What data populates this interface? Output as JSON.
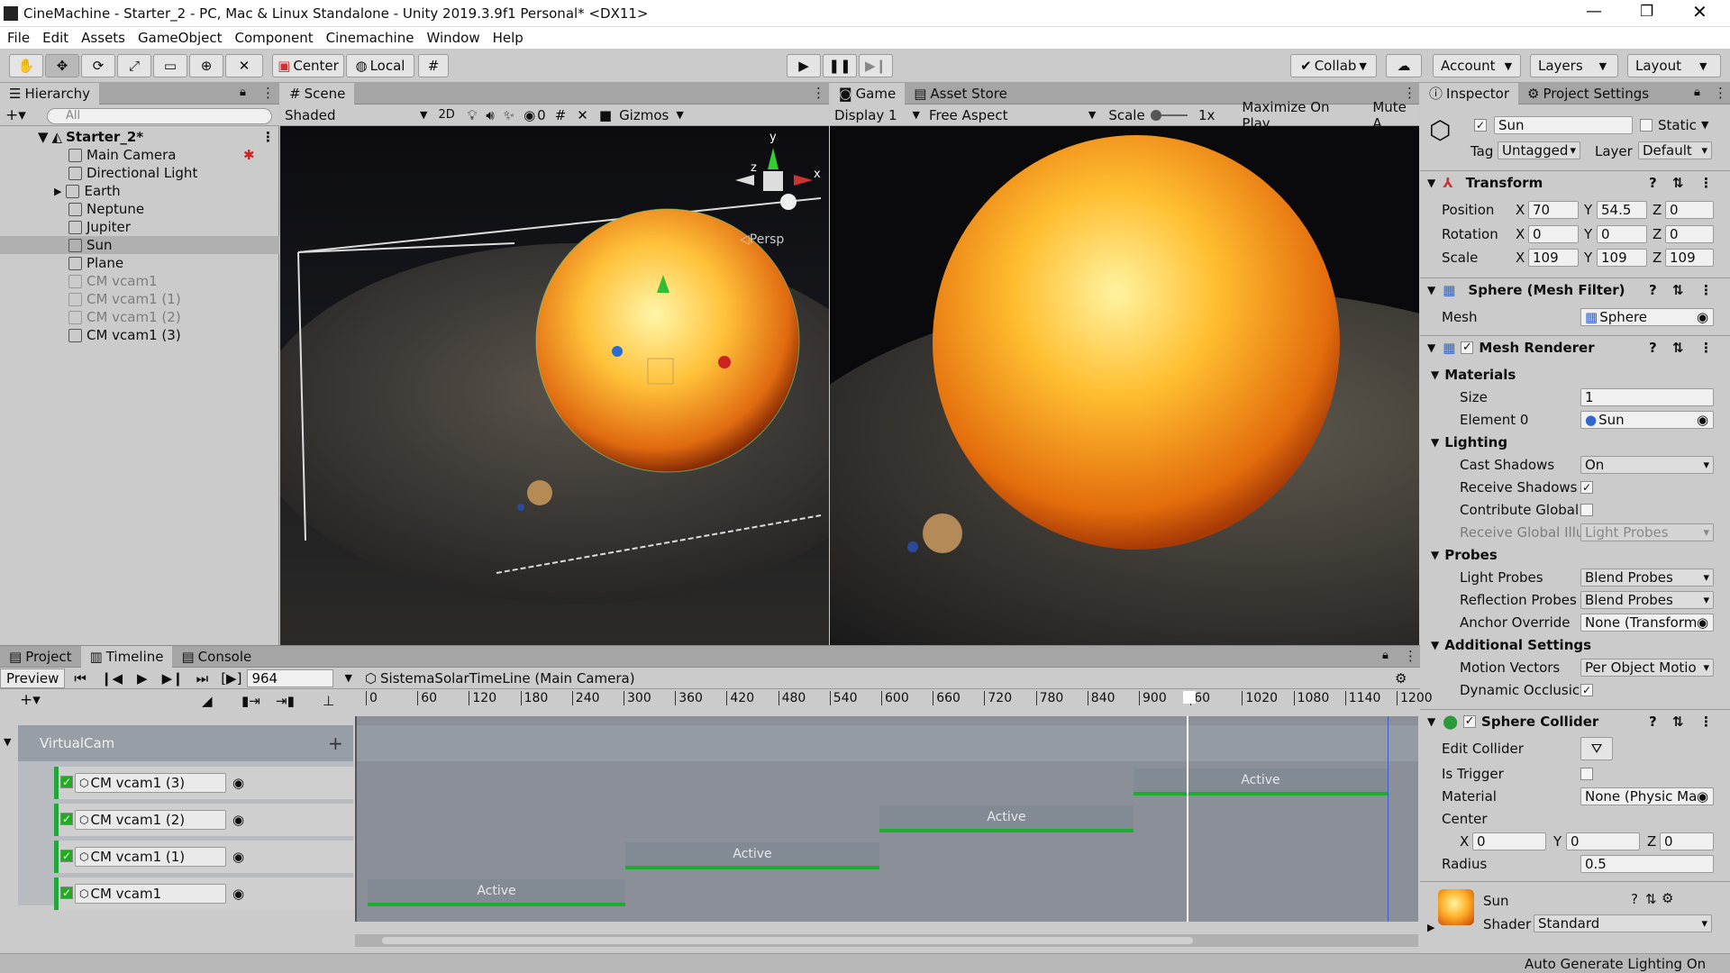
{
  "title": "CineMachine - Starter_2 - PC, Mac & Linux Standalone - Unity 2019.3.9f1 Personal* <DX11>",
  "menu": [
    "File",
    "Edit",
    "Assets",
    "GameObject",
    "Component",
    "Cinemachine",
    "Window",
    "Help"
  ],
  "toolbar": {
    "center": "Center",
    "local": "Local",
    "collab": "Collab",
    "account": "Account",
    "layers": "Layers",
    "layout": "Layout"
  },
  "hierarchy": {
    "tab": "Hierarchy",
    "search": "All",
    "scene": "Starter_2*",
    "items": [
      "Main Camera",
      "Directional Light",
      "Earth",
      "Neptune",
      "Jupiter",
      "Sun",
      "Plane",
      "CM vcam1",
      "CM vcam1 (1)",
      "CM vcam1 (2)",
      "CM vcam1 (3)"
    ]
  },
  "scene": {
    "tab": "Scene",
    "shading": "Shaded",
    "mode2d": "2D",
    "hidden_count": "0",
    "gizmos": "Gizmos",
    "persp": "Persp"
  },
  "game": {
    "tab": "Game",
    "asset_tab": "Asset Store",
    "display": "Display 1",
    "aspect": "Free Aspect",
    "scale_label": "Scale",
    "scale_value": "1x",
    "maximize": "Maximize On Play",
    "mute": "Mute A"
  },
  "inspector": {
    "tab": "Inspector",
    "settings_tab": "Project Settings",
    "name": "Sun",
    "static": "Static",
    "tag_label": "Tag",
    "tag": "Untagged",
    "layer_label": "Layer",
    "layer": "Default",
    "transform": {
      "title": "Transform",
      "position_label": "Position",
      "rotation_label": "Rotation",
      "scale_label": "Scale",
      "pos": [
        "70",
        "54.5",
        "0"
      ],
      "rot": [
        "0",
        "0",
        "0"
      ],
      "scl": [
        "109",
        "109",
        "109"
      ]
    },
    "mesh_filter": {
      "title": "Sphere (Mesh Filter)",
      "mesh_label": "Mesh",
      "mesh": "Sphere"
    },
    "mesh_renderer": {
      "title": "Mesh Renderer",
      "materials": "Materials",
      "size_label": "Size",
      "size": "1",
      "element_label": "Element 0",
      "element": "Sun",
      "lighting": "Lighting",
      "cast_label": "Cast Shadows",
      "cast": "On",
      "receive_label": "Receive Shadows",
      "contribute_label": "Contribute Global",
      "receive_gi_label": "Receive Global Illu",
      "receive_gi": "Light Probes",
      "probes": "Probes",
      "light_probes_label": "Light Probes",
      "light_probes": "Blend Probes",
      "reflection_label": "Reflection Probes",
      "reflection": "Blend Probes",
      "anchor_label": "Anchor Override",
      "anchor": "None (Transform",
      "additional": "Additional Settings",
      "motion_label": "Motion Vectors",
      "motion": "Per Object Motio",
      "dynamic_label": "Dynamic Occlusic"
    },
    "collider": {
      "title": "Sphere Collider",
      "edit_label": "Edit Collider",
      "trigger_label": "Is Trigger",
      "material_label": "Material",
      "material": "None (Physic Ma",
      "center_label": "Center",
      "center": [
        "0",
        "0",
        "0"
      ],
      "radius_label": "Radius",
      "radius": "0.5"
    },
    "material": {
      "name": "Sun",
      "shader_label": "Shader",
      "shader": "Standard"
    }
  },
  "bottom": {
    "tabs": [
      "Project",
      "Timeline",
      "Console"
    ],
    "preview": "Preview",
    "frame": "964",
    "timeline_name": "SistemaSolarTimeLine (Main Camera)",
    "group": "VirtualCam",
    "tracks": [
      "CM vcam1 (3)",
      "CM vcam1 (2)",
      "CM vcam1 (1)",
      "CM vcam1"
    ],
    "clip_label": "Active",
    "ruler": [
      "0",
      "60",
      "120",
      "180",
      "240",
      "300",
      "360",
      "420",
      "480",
      "540",
      "600",
      "660",
      "720",
      "780",
      "840",
      "900",
      "60",
      "1020",
      "1080",
      "1140",
      "1200"
    ]
  },
  "status": "Auto Generate Lighting On"
}
